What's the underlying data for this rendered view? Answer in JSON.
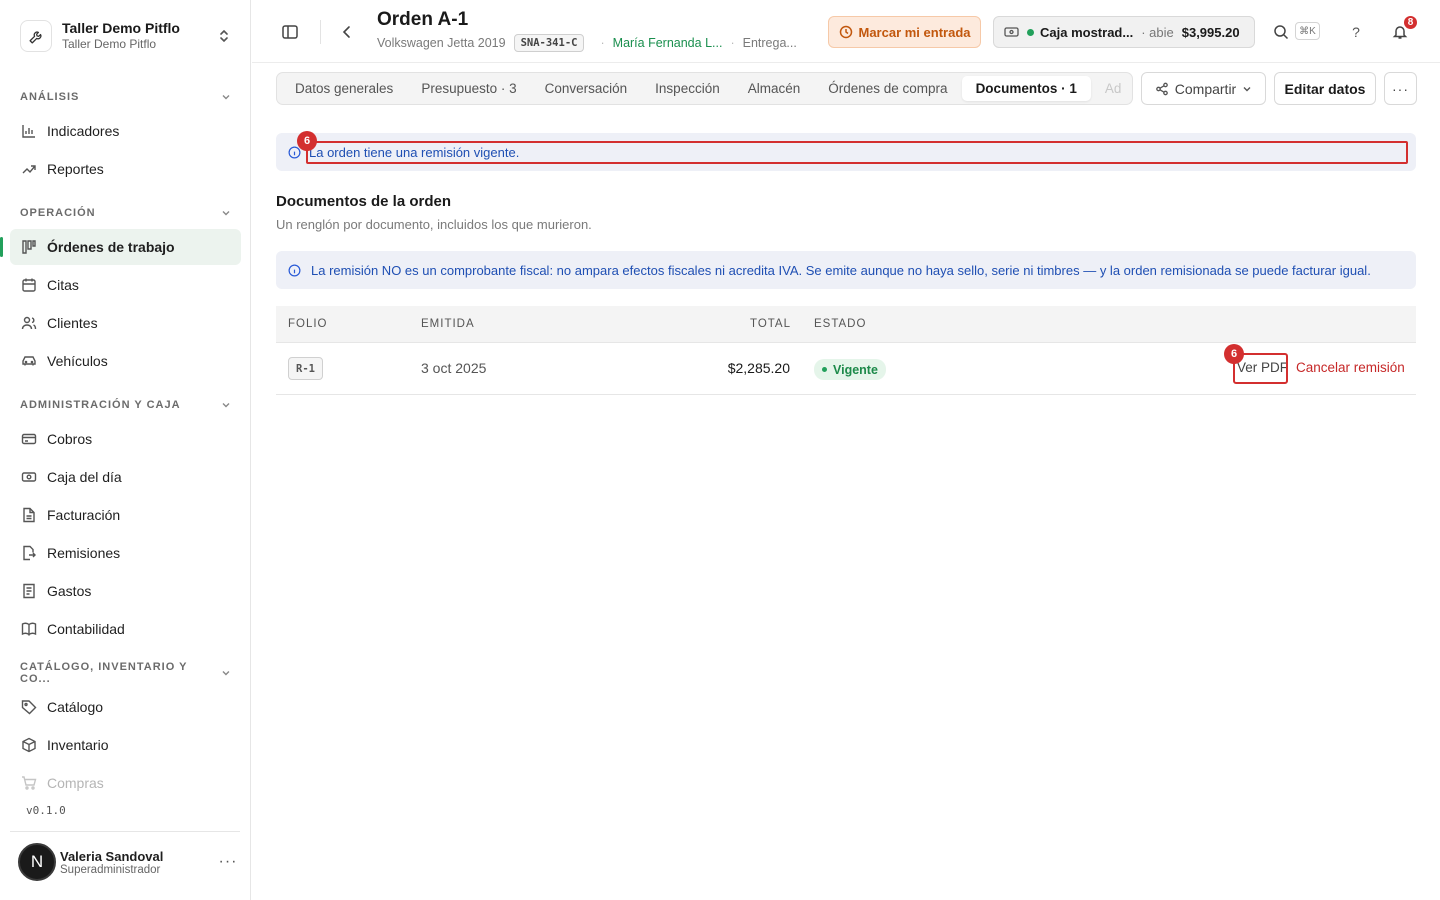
{
  "workspace": {
    "name": "Taller Demo Pitflo",
    "subtitle": "Taller Demo Pitflo"
  },
  "sidebar": {
    "sections": [
      {
        "title": "ANÁLISIS",
        "items": [
          {
            "label": "Indicadores",
            "icon": "bar-chart-icon"
          },
          {
            "label": "Reportes",
            "icon": "trend-icon"
          }
        ]
      },
      {
        "title": "OPERACIÓN",
        "items": [
          {
            "label": "Órdenes de trabajo",
            "icon": "kanban-icon",
            "active": true
          },
          {
            "label": "Citas",
            "icon": "calendar-icon"
          },
          {
            "label": "Clientes",
            "icon": "users-icon"
          },
          {
            "label": "Vehículos",
            "icon": "car-icon"
          }
        ]
      },
      {
        "title": "ADMINISTRACIÓN Y CAJA",
        "items": [
          {
            "label": "Cobros",
            "icon": "credit-card-icon"
          },
          {
            "label": "Caja del día",
            "icon": "cash-icon"
          },
          {
            "label": "Facturación",
            "icon": "file-icon"
          },
          {
            "label": "Remisiones",
            "icon": "file-export-icon"
          },
          {
            "label": "Gastos",
            "icon": "receipt-icon"
          },
          {
            "label": "Contabilidad",
            "icon": "book-icon"
          }
        ]
      },
      {
        "title": "CATÁLOGO, INVENTARIO Y CO...",
        "items": [
          {
            "label": "Catálogo",
            "icon": "tag-icon"
          },
          {
            "label": "Inventario",
            "icon": "box-icon"
          },
          {
            "label": "Compras",
            "icon": "cart-icon"
          }
        ]
      }
    ],
    "version": "v0.1.0",
    "user": {
      "initial": "N",
      "name": "Valeria Sandoval",
      "role": "Superadministrador"
    }
  },
  "header": {
    "title": "Orden A-1",
    "vehicle": "Volkswagen Jetta 2019",
    "plate": "SNA-341-C",
    "customer": "María Fernanda L...",
    "stage": "Entrega...",
    "entry_button": "Marcar mi entrada",
    "cash": {
      "name": "Caja mostrad...",
      "status": "abie",
      "amount": "$3,995.20"
    },
    "shortcut": "⌘K",
    "help": "?",
    "notifications": "8"
  },
  "tabs": [
    "Datos generales",
    "Presupuesto · 3",
    "Conversación",
    "Inspección",
    "Almacén",
    "Órdenes de compra",
    "Documentos · 1",
    "Ad"
  ],
  "actions": {
    "share": "Compartir",
    "edit": "Editar datos",
    "more": "···"
  },
  "banner": {
    "text": "La orden tiene una remisión vigente.",
    "marker": "6"
  },
  "documents": {
    "title": "Documentos de la orden",
    "subtitle": "Un renglón por documento, incluidos los que murieron.",
    "info": "La remisión NO es un comprobante fiscal: no ampara efectos fiscales ni acredita IVA. Se emite aunque no haya sello, serie ni timbres — y la orden remisionada se puede facturar igual.",
    "columns": {
      "folio": "FOLIO",
      "issued": "EMITIDA",
      "total": "TOTAL",
      "status": "ESTADO"
    },
    "rows": [
      {
        "folio": "R-1",
        "issued": "3 oct 2025",
        "total": "$2,285.20",
        "status": "Vigente",
        "view_pdf": "Ver PDF",
        "cancel": "Cancelar remisión",
        "marker": "6"
      }
    ]
  },
  "colors": {
    "accent_green": "#22a05b",
    "highlight_red": "#d32f2f",
    "info_blue": "#1f4fb3"
  }
}
